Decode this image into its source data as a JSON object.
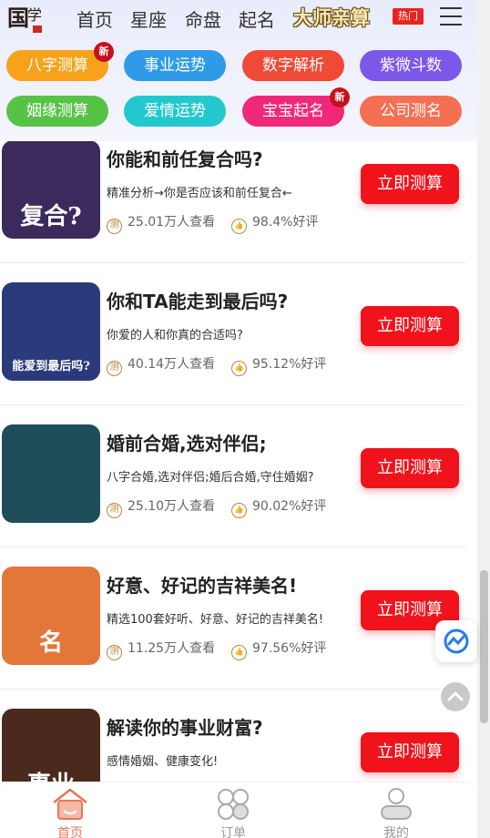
{
  "header": {
    "nav": [
      "首页",
      "星座",
      "命盘",
      "起名"
    ],
    "master": "大师亲算",
    "hot_badge": "热门",
    "categories": [
      {
        "label": "八字测算",
        "color": "#f7a21a",
        "badge": "新"
      },
      {
        "label": "事业运势",
        "color": "#2f9be8",
        "badge": ""
      },
      {
        "label": "数字解析",
        "color": "#ef4a36",
        "badge": ""
      },
      {
        "label": "紫微斗数",
        "color": "#7b58e8",
        "badge": ""
      },
      {
        "label": "姻缘测算",
        "color": "#56c246",
        "badge": ""
      },
      {
        "label": "爱情运势",
        "color": "#23c8cf",
        "badge": ""
      },
      {
        "label": "宝宝起名",
        "color": "#f0287a",
        "badge": "新"
      },
      {
        "label": "公司测名",
        "color": "#f56f53",
        "badge": ""
      }
    ]
  },
  "items": [
    {
      "title": "你能和前任复合吗?",
      "desc": "精准分析→你是否应该和前任复合←",
      "views": "25.01万人查看",
      "rating": "98.4%好评",
      "button": "立即测算",
      "thumb_text": "复合?",
      "thumb_bg": "#3b2a5c"
    },
    {
      "title": "你和TA能走到最后吗?",
      "desc": "你爱的人和你真的合适吗?",
      "views": "40.14万人查看",
      "rating": "95.12%好评",
      "button": "立即测算",
      "thumb_text": "能爱到最后吗?",
      "thumb_bg": "#2b3a7a"
    },
    {
      "title": "婚前合婚,选对伴侣;",
      "desc": "八字合婚,选对伴侣;婚后合婚,守住婚姻?",
      "views": "25.10万人查看",
      "rating": "90.02%好评",
      "button": "立即测算",
      "thumb_text": "",
      "thumb_bg": "#1e4e5a"
    },
    {
      "title": "好意、好记的吉祥美名!",
      "desc": "精选100套好听、好意、好记的吉祥美名!",
      "views": "11.25万人查看",
      "rating": "97.56%好评",
      "button": "立即测算",
      "thumb_text": "名",
      "thumb_bg": "#e3773a"
    },
    {
      "title": "解读你的事业财富?",
      "desc": "感情婚姻、健康变化!",
      "views": "",
      "rating": "",
      "button": "立即测算",
      "thumb_text": "事业",
      "thumb_bg": "#4a2a1c"
    }
  ],
  "stat_icons": {
    "views": "测",
    "rating": "👍"
  },
  "tabbar": [
    {
      "label": "首页",
      "icon": "home-icon",
      "active": true
    },
    {
      "label": "订单",
      "icon": "order-icon",
      "active": false
    },
    {
      "label": "我的",
      "icon": "user-icon",
      "active": false
    }
  ],
  "colors": {
    "accent": "#f0131b",
    "tab_active": "#e8765a",
    "tab_inactive": "#999999"
  }
}
